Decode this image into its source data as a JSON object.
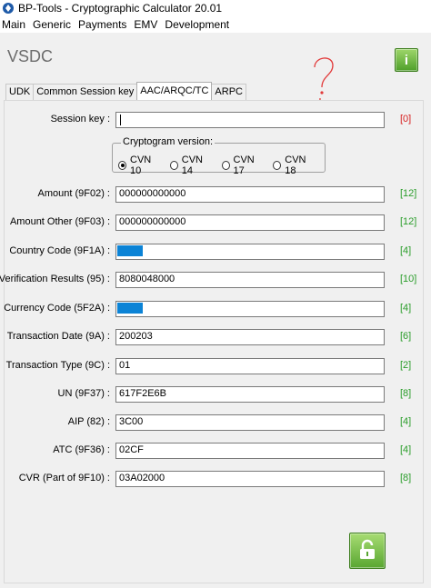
{
  "window": {
    "title": "BP-Tools - Cryptographic Calculator 20.01"
  },
  "menu": [
    "Main",
    "Generic",
    "Payments",
    "EMV",
    "Development"
  ],
  "heading": "VSDC",
  "tabs": [
    "UDK",
    "Common Session key",
    "AAC/ARQC/TC",
    "ARPC"
  ],
  "active_tab": "AAC/ARQC/TC",
  "session_key": {
    "label": "Session key :",
    "value": "",
    "count": "[0]"
  },
  "cryptogram": {
    "legend": "Cryptogram version:",
    "options": [
      "CVN 10",
      "CVN 14",
      "CVN 17",
      "CVN 18"
    ],
    "selected": "CVN 10"
  },
  "fields": [
    {
      "label": "Amount (9F02) :",
      "value": "000000000000",
      "count": "[12]"
    },
    {
      "label": "Amount Other (9F03) :",
      "value": "000000000000",
      "count": "[12]"
    },
    {
      "label": "Country Code (9F1A) :",
      "value": "",
      "count": "[4]",
      "redacted": true
    },
    {
      "label": "Verification Results (95) :",
      "value": "8080048000",
      "count": "[10]"
    },
    {
      "label": "Currency Code (5F2A) :",
      "value": "",
      "count": "[4]",
      "redacted": true
    },
    {
      "label": "Transaction Date (9A) :",
      "value": "200203",
      "count": "[6]"
    },
    {
      "label": "Transaction Type (9C) :",
      "value": "01",
      "count": "[2]"
    },
    {
      "label": "UN (9F37) :",
      "value": "617F2E6B",
      "count": "[8]"
    },
    {
      "label": "AIP (82) :",
      "value": "3C00",
      "count": "[4]"
    },
    {
      "label": "ATC (9F36) :",
      "value": "02CF",
      "count": "[4]"
    },
    {
      "label": "CVR (Part of 9F10) :",
      "value": "03A02000",
      "count": "[8]"
    }
  ],
  "colors": {
    "count_ok": "#2a9d2a",
    "count_error": "#d61e1e",
    "redaction": "#0b83d6",
    "button_green": "#59a631"
  },
  "icons": {
    "info_button": "info-icon",
    "lock_button": "unlock-icon"
  }
}
